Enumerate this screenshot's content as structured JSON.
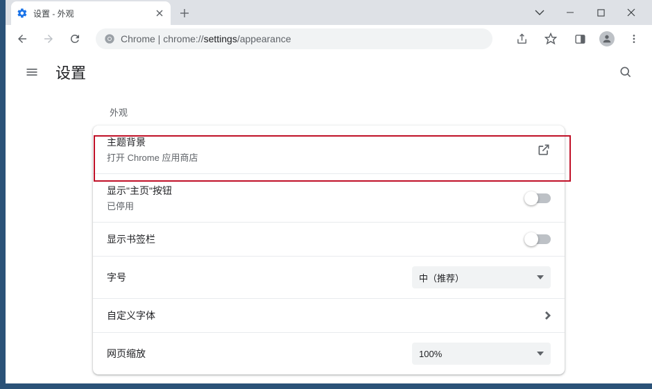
{
  "tab": {
    "title": "设置 - 外观"
  },
  "omnibox": {
    "scheme_label": "Chrome",
    "url_path": "chrome://settings/appearance"
  },
  "page": {
    "title": "设置"
  },
  "section": {
    "label": "外观"
  },
  "rows": {
    "theme": {
      "title": "主题背景",
      "desc": "打开 Chrome 应用商店"
    },
    "homebtn": {
      "title": "显示\"主页\"按钮",
      "desc": "已停用"
    },
    "bookmarks": {
      "title": "显示书签栏"
    },
    "fontsize": {
      "title": "字号",
      "value": "中（推荐）"
    },
    "customfont": {
      "title": "自定义字体"
    },
    "zoom": {
      "title": "网页缩放",
      "value": "100%"
    }
  }
}
